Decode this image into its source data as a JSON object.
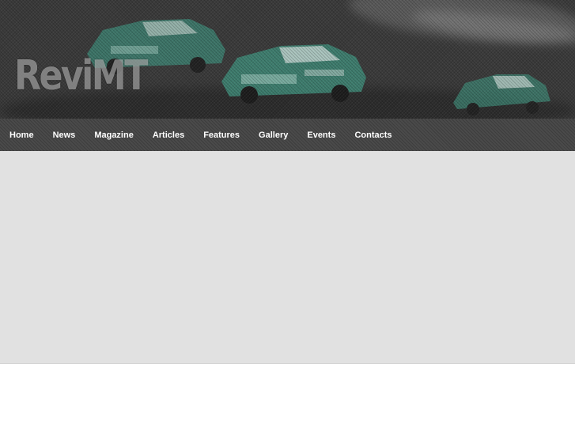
{
  "header": {
    "logo_text": "ReviMT",
    "tagline": ""
  },
  "nav": {
    "items": [
      {
        "label": "Home"
      },
      {
        "label": "News"
      },
      {
        "label": "Magazine"
      },
      {
        "label": "Articles"
      },
      {
        "label": "Features"
      },
      {
        "label": "Gallery"
      },
      {
        "label": "Events"
      },
      {
        "label": "Contacts"
      }
    ]
  },
  "colors": {
    "nav_background": "#4a4a4a",
    "nav_text": "#ffffff",
    "content_background": "#e1e1e1",
    "car_livery": "#3f8a78"
  }
}
